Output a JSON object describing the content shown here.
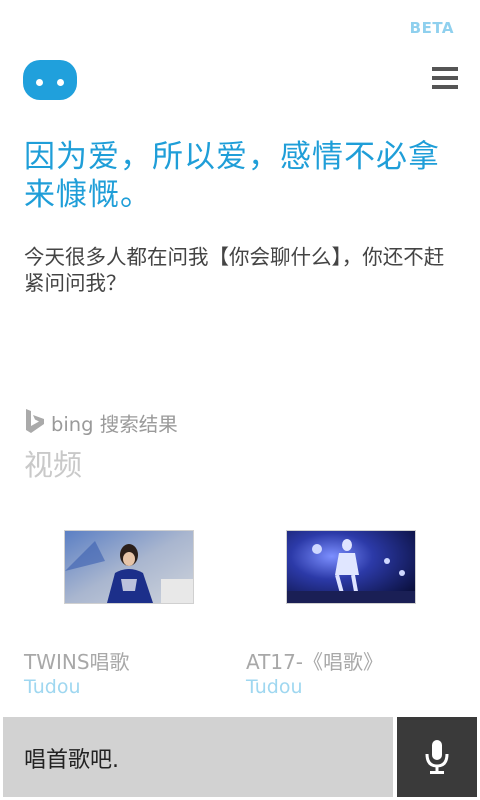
{
  "header": {
    "badge": "BETA",
    "logo_icon": "cortana-blob-icon",
    "menu_icon": "hamburger-menu-icon"
  },
  "response": {
    "headline": "因为爱，所以爱，感情不必拿来慷慨。",
    "body": "今天很多人都在问我【你会聊什么】，你还不赶紧问问我？"
  },
  "search": {
    "provider_text": "bing 搜索结果",
    "section_title": "视频",
    "videos": [
      {
        "title": "TWINS唱歌",
        "source": "Tudou"
      },
      {
        "title": "AT17-《唱歌》",
        "source": "Tudou"
      }
    ]
  },
  "input": {
    "text": "唱首歌吧.",
    "mic_icon": "microphone-icon"
  },
  "colors": {
    "accent": "#1f9ed8",
    "badge": "#8fd0ee",
    "input_bg": "#d2d2d2",
    "mic_bg": "#3a3a3a"
  }
}
